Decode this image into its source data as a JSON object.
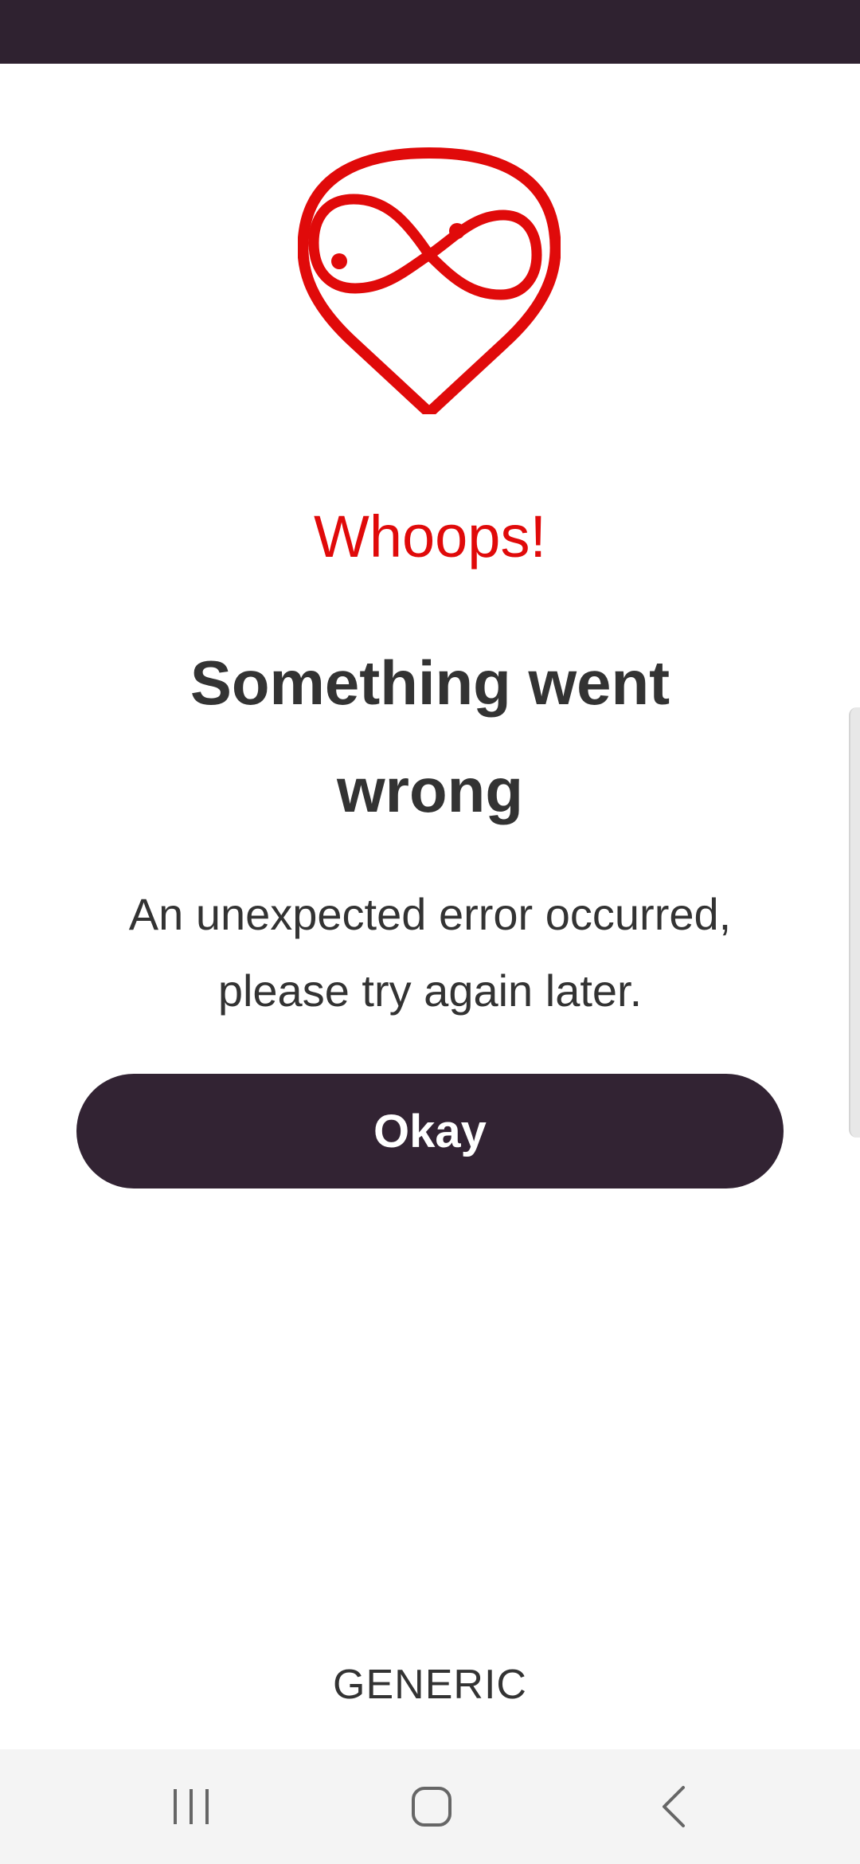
{
  "screen": {
    "headline": "Whoops!",
    "title": "Something went wrong",
    "message": "An unexpected error occurred, please try again later.",
    "okay_button_label": "Okay",
    "footer_label": "GENERIC"
  },
  "icons": {
    "logo": "heart-infinity-logo-icon",
    "nav_recent": "recent-apps-icon",
    "nav_home": "home-icon",
    "nav_back": "back-icon"
  },
  "colors": {
    "status_bar": "#2f2230",
    "accent_red": "#e00a0a",
    "button_bg": "#322333",
    "text": "#333333",
    "nav_bar_bg": "#f4f4f4"
  }
}
